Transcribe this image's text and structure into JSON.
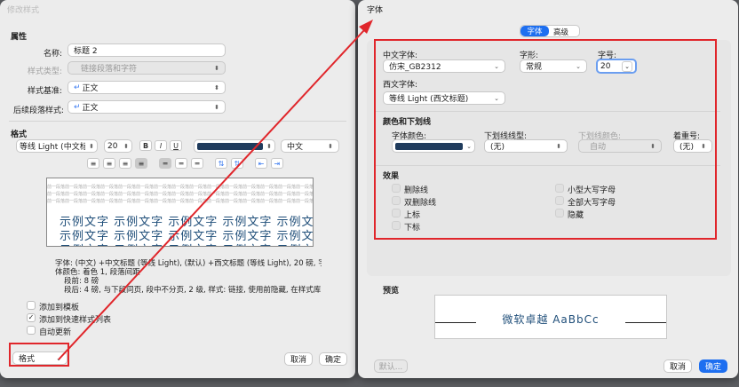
{
  "left_dialog": {
    "title": "修改样式",
    "properties_heading": "属性",
    "name_label": "名称:",
    "name_value": "标题 2",
    "style_type_label": "样式类型:",
    "style_type_value": "链接段落和字符",
    "based_on_label": "样式基准:",
    "based_on_value": "正文",
    "next_style_label": "后续段落样式:",
    "next_style_value": "正文",
    "format_heading": "格式",
    "font_value": "等线 Light (中文标题)",
    "size_value": "20",
    "bold": "B",
    "italic": "I",
    "underline": "U",
    "font_color": "#1f3b5c",
    "script_value": "中文",
    "preview_gray_text": "前一段落前一段落前一段落前一段落前一段落前一段落前一段落前一段落前一段落前一段落前一段落前一段落前一段落前一段落前一段落前一段落",
    "preview_sample_text": "示例文字 示例文字 示例文字 示例文字 示例文字",
    "description_line1": "字体: (中文) +中文标题 (等线 Light), (默认) +西文标题 (等线 Light), 20 磅, 字",
    "description_line2": "体颜色: 着色 1, 段落间距",
    "description_line3": "段前: 8 磅",
    "description_line4": "段后: 4 磅, 与下段同页, 段中不分页, 2 级, 样式: 链接, 使用前隐藏, 在样式库",
    "add_template_label": "添加到模板",
    "add_quick_label": "添加到快速样式列表",
    "add_quick_checked": "✓",
    "auto_update_label": "自动更新",
    "format_button": "格式",
    "cancel_button": "取消",
    "ok_button": "确定"
  },
  "right_dialog": {
    "title": "字体",
    "tab_font": "字体",
    "tab_advanced": "高级",
    "cn_font_label": "中文字体:",
    "cn_font_value": "仿宋_GB2312",
    "style_label": "字形:",
    "style_value": "常规",
    "size_label": "字号:",
    "size_value": "20",
    "west_font_label": "西文字体:",
    "west_font_value": "等线 Light (西文标题)",
    "color_section": "颜色和下划线",
    "font_color_label": "字体颜色:",
    "font_color": "#1f3b5c",
    "underline_type_label": "下划线线型:",
    "underline_type_value": "(无)",
    "underline_color_label": "下划线颜色:",
    "underline_color_value": "自动",
    "emphasis_label": "着重号:",
    "emphasis_value": "(无)",
    "effects_section": "效果",
    "effects_left": [
      "删除线",
      "双删除线",
      "上标",
      "下标"
    ],
    "effects_right": [
      "小型大写字母",
      "全部大写字母",
      "隐藏"
    ],
    "preview_section": "预览",
    "preview_text": "微软卓越 AaBbCc",
    "default_button": "默认...",
    "cancel_button": "取消",
    "ok_button": "确定"
  },
  "annotation_color": "#e0262b"
}
